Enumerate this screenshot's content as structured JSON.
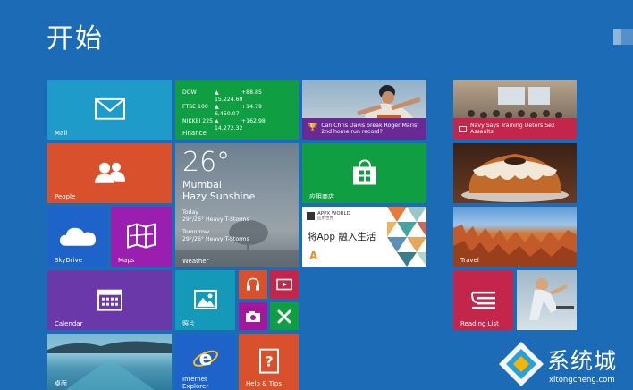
{
  "header": {
    "title": "开始"
  },
  "tiles": {
    "mail": {
      "label": "Mail"
    },
    "finance": {
      "label": "Finance",
      "rows": [
        {
          "name": "DOW",
          "value": "▲ 15,224.69",
          "change": "+88.85"
        },
        {
          "name": "FTSE 100",
          "value": "▲ 6,450.07",
          "change": "+14.79"
        },
        {
          "name": "NIKKEI 225",
          "value": "▲ 14,272.32",
          "change": "+162.98"
        }
      ]
    },
    "sports": {
      "headline": "Can Chris Davis break Roger Maris' 2nd home run record?"
    },
    "people": {
      "label": "People"
    },
    "weather": {
      "label": "Weather",
      "temp": "26°",
      "city": "Mumbai",
      "condition": "Hazy Sunshine",
      "today_label": "Today",
      "today_forecast": "29°/26° Heavy T-Storms",
      "tomorrow_label": "Tomorrow",
      "tomorrow_forecast": "29°/26° Heavy T-Storms"
    },
    "store": {
      "label": "应用商店"
    },
    "appx": {
      "brand": "APPX WORLD",
      "brand_sub": "应用世界",
      "text": "将App 融入生活",
      "letter": "A"
    },
    "skydrive": {
      "label": "SkyDrive"
    },
    "maps": {
      "label": "Maps"
    },
    "calendar": {
      "label": "Calendar"
    },
    "photos": {
      "label": "照片"
    },
    "desktop": {
      "label": "桌面"
    },
    "ie": {
      "label": "Internet Explorer"
    },
    "help": {
      "label": "Help & Tips"
    },
    "news": {
      "headline": "Navy Says Training Deters Sex Assaults"
    },
    "travel": {
      "label": "Travel"
    },
    "reading": {
      "label": "Reading List"
    }
  },
  "watermark": {
    "text": "系统城",
    "url": "xitongcheng.com"
  },
  "colors": {
    "background": "#1c6bb7",
    "mail": "#1f9bc9",
    "finance": "#109e42",
    "people": "#d9512c",
    "store": "#109e42",
    "skydrive": "#1e63c9",
    "maps": "#9a1eb0",
    "calendar": "#6a38a8",
    "photos": "#149ab8",
    "music": "#d9512c",
    "video": "#c4254b",
    "camera": "#a4179a",
    "games": "#109e42",
    "ie": "#1e63c9",
    "help": "#d9512c",
    "reading": "#c4254b",
    "sports_bar": "#6a2a95",
    "news_bar": "#c4254b"
  }
}
